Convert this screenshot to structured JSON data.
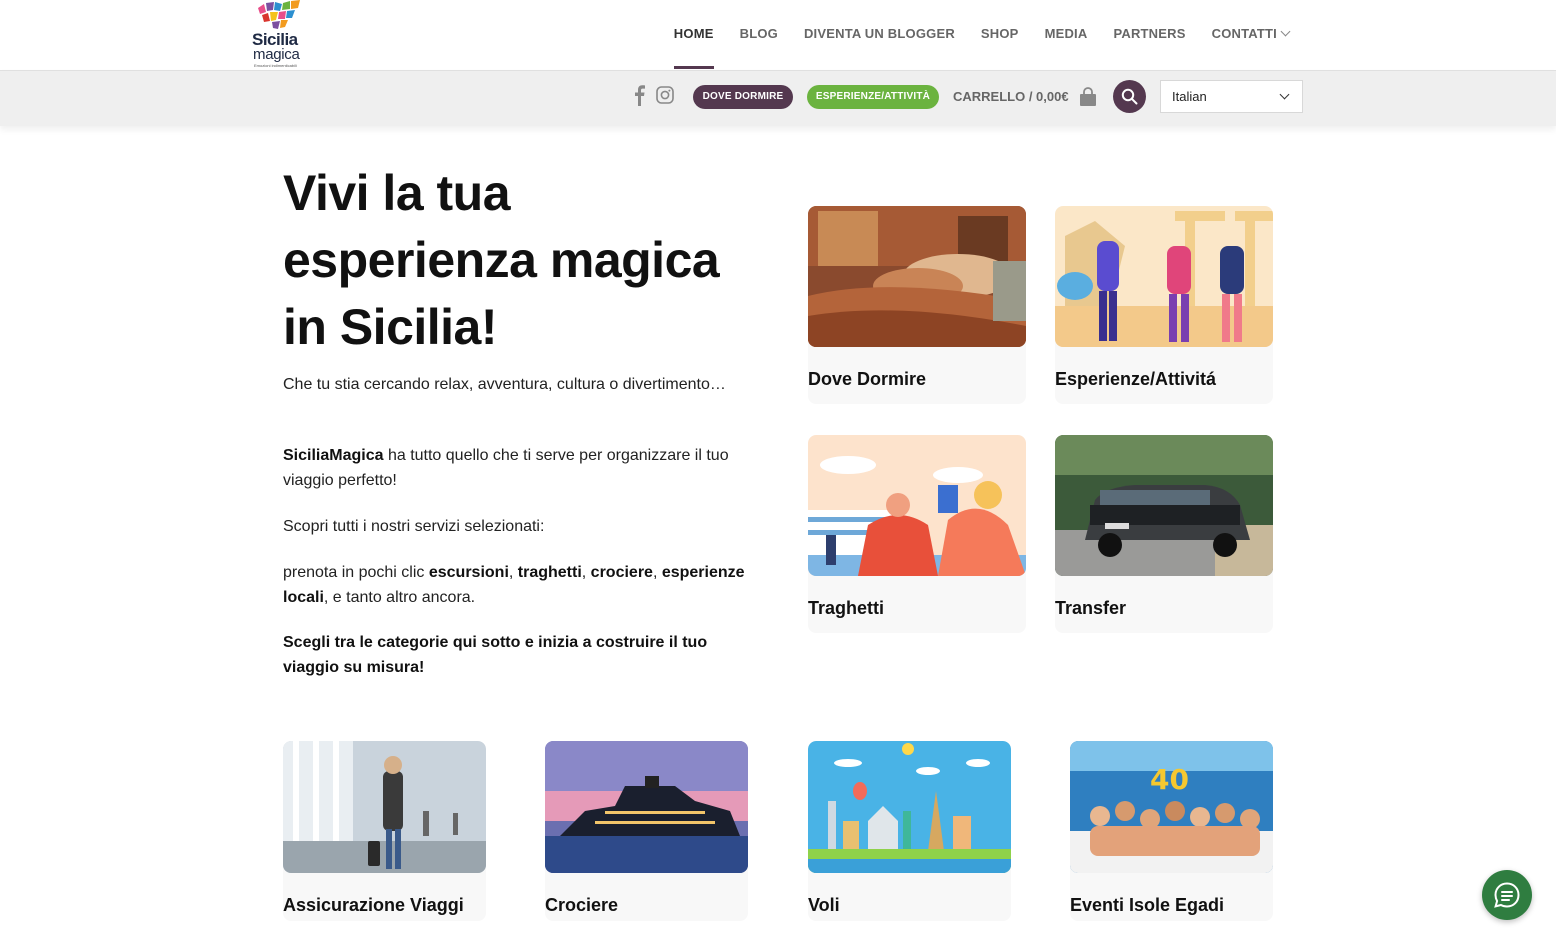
{
  "brand": {
    "line1": "Sicilia",
    "line2": "magica",
    "tagline": "Emozioni indimenticabili"
  },
  "nav": {
    "items": [
      {
        "label": "HOME",
        "active": true
      },
      {
        "label": "BLOG"
      },
      {
        "label": "DIVENTA UN BLOGGER"
      },
      {
        "label": "SHOP"
      },
      {
        "label": "MEDIA"
      },
      {
        "label": "PARTNERS"
      },
      {
        "label": "CONTATTI",
        "has_dropdown": true
      }
    ]
  },
  "subbar": {
    "social": [
      "facebook-icon",
      "instagram-icon"
    ],
    "pill_dove": "DOVE DORMIRE",
    "pill_esp": "ESPERIENZE/ATTIVITÀ",
    "cart": "CARRELLO / 0,00€",
    "language": "Italian"
  },
  "hero": {
    "title": "Vivi la tua esperienza magica in Sicilia!",
    "p1": "Che tu stia cercando relax, avventura, cultura o divertimento…",
    "p2_bold": "SiciliaMagica",
    "p2_rest": " ha tutto quello che ti serve per organizzare il tuo viaggio perfetto!",
    "p3": "Scopri tutti i nostri servizi selezionati:",
    "p4": {
      "a": "prenota in pochi clic ",
      "b": "escursioni",
      "c": ", ",
      "d": "traghetti",
      "e": ", ",
      "f": "crociere",
      "g": ", ",
      "h": "esperienze locali",
      "i": ", e tanto altro ancora."
    },
    "p5": "Scegli tra le categorie qui sotto e inizia a costruire il tuo viaggio su misura!"
  },
  "cards": {
    "dove": "Dove Dormire",
    "esp": "Esperienze/Attivitá",
    "traghetti": "Traghetti",
    "transfer": "Transfer",
    "assicurazione": "Assicurazione Viaggi",
    "crociere": "Crociere",
    "voli": "Voli",
    "eventi": "Eventi Isole Egadi"
  },
  "colors": {
    "brand_purple": "#54384f",
    "brand_green": "#6bb33f",
    "chat_green": "#2f7d40"
  }
}
